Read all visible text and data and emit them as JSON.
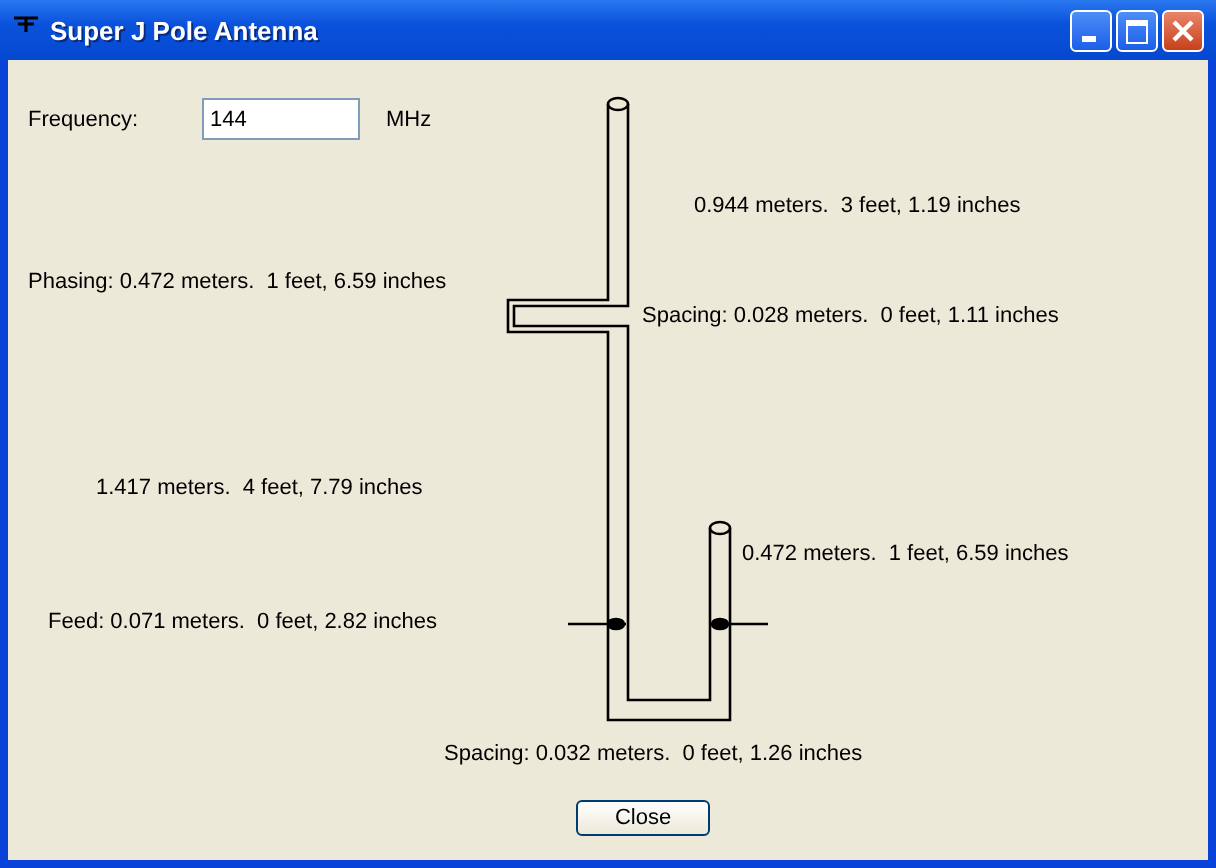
{
  "window": {
    "title": "Super J Pole Antenna"
  },
  "frequency": {
    "label": "Frequency:",
    "value": "144",
    "unit": "MHz"
  },
  "measurements": [
    {
      "text": "0.944 meters.  3 feet, 1.19 inches"
    },
    {
      "text": "Phasing: 0.472 meters.  1 feet, 6.59 inches"
    },
    {
      "text": "Spacing: 0.028 meters.  0 feet, 1.11 inches"
    },
    {
      "text": "1.417 meters.  4 feet, 7.79 inches"
    },
    {
      "text": "0.472 meters.  1 feet, 6.59 inches"
    },
    {
      "text": "Feed: 0.071 meters.  0 feet, 2.82 inches"
    },
    {
      "text": "Spacing: 0.032 meters.  0 feet, 1.26 inches"
    }
  ],
  "buttons": [
    "Close"
  ]
}
